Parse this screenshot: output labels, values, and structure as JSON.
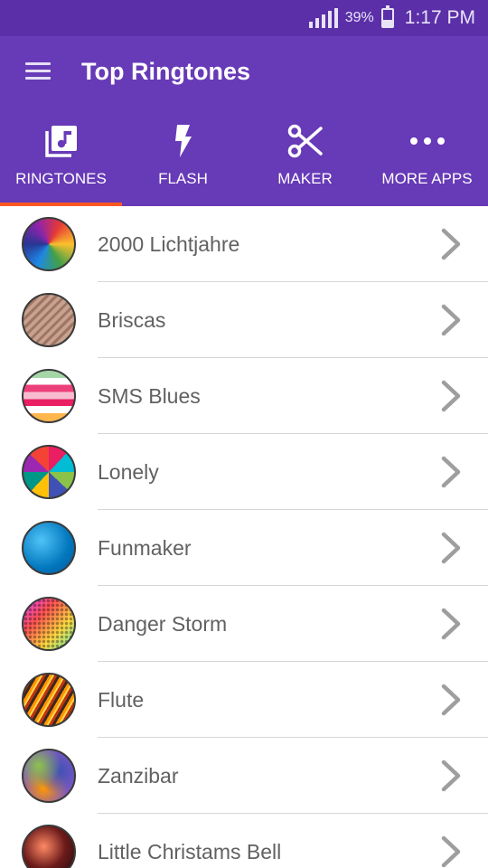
{
  "status_bar": {
    "battery_percent": "39%",
    "battery_level": 0.39,
    "time": "1:17 PM",
    "icons": [
      "signal-icon",
      "battery-icon"
    ]
  },
  "app_bar": {
    "title": "Top Ringtones",
    "icon": "menu-icon"
  },
  "colors": {
    "primary": "#673ab7",
    "status_bar": "#5a2fa8",
    "tab_indicator": "#ff5722",
    "item_text": "#616161",
    "divider": "#d7d7d7"
  },
  "tabs": [
    {
      "label": "RINGTONES",
      "icon": "music-note-icon",
      "selected": true
    },
    {
      "label": "FLASH",
      "icon": "flash-icon",
      "selected": false
    },
    {
      "label": "MAKER",
      "icon": "scissors-icon",
      "selected": false
    },
    {
      "label": "MORE APPS",
      "icon": "more-dots-icon",
      "selected": false
    }
  ],
  "ringtones": [
    {
      "title": "2000 Lichtjahre",
      "thumb": "colorful-swirl-thumbnail"
    },
    {
      "title": "Briscas",
      "thumb": "striped-texture-thumbnail"
    },
    {
      "title": "SMS Blues",
      "thumb": "pink-stripes-thumbnail"
    },
    {
      "title": "Lonely",
      "thumb": "geometric-triangles-thumbnail"
    },
    {
      "title": "Funmaker",
      "thumb": "blue-texture-thumbnail"
    },
    {
      "title": "Danger Storm",
      "thumb": "halftone-thumbnail"
    },
    {
      "title": "Flute",
      "thumb": "gold-lines-thumbnail"
    },
    {
      "title": "Zanzibar",
      "thumb": "blurred-colors-thumbnail"
    },
    {
      "title": "Little Christams Bell",
      "thumb": "dark-swirl-thumbnail"
    }
  ]
}
